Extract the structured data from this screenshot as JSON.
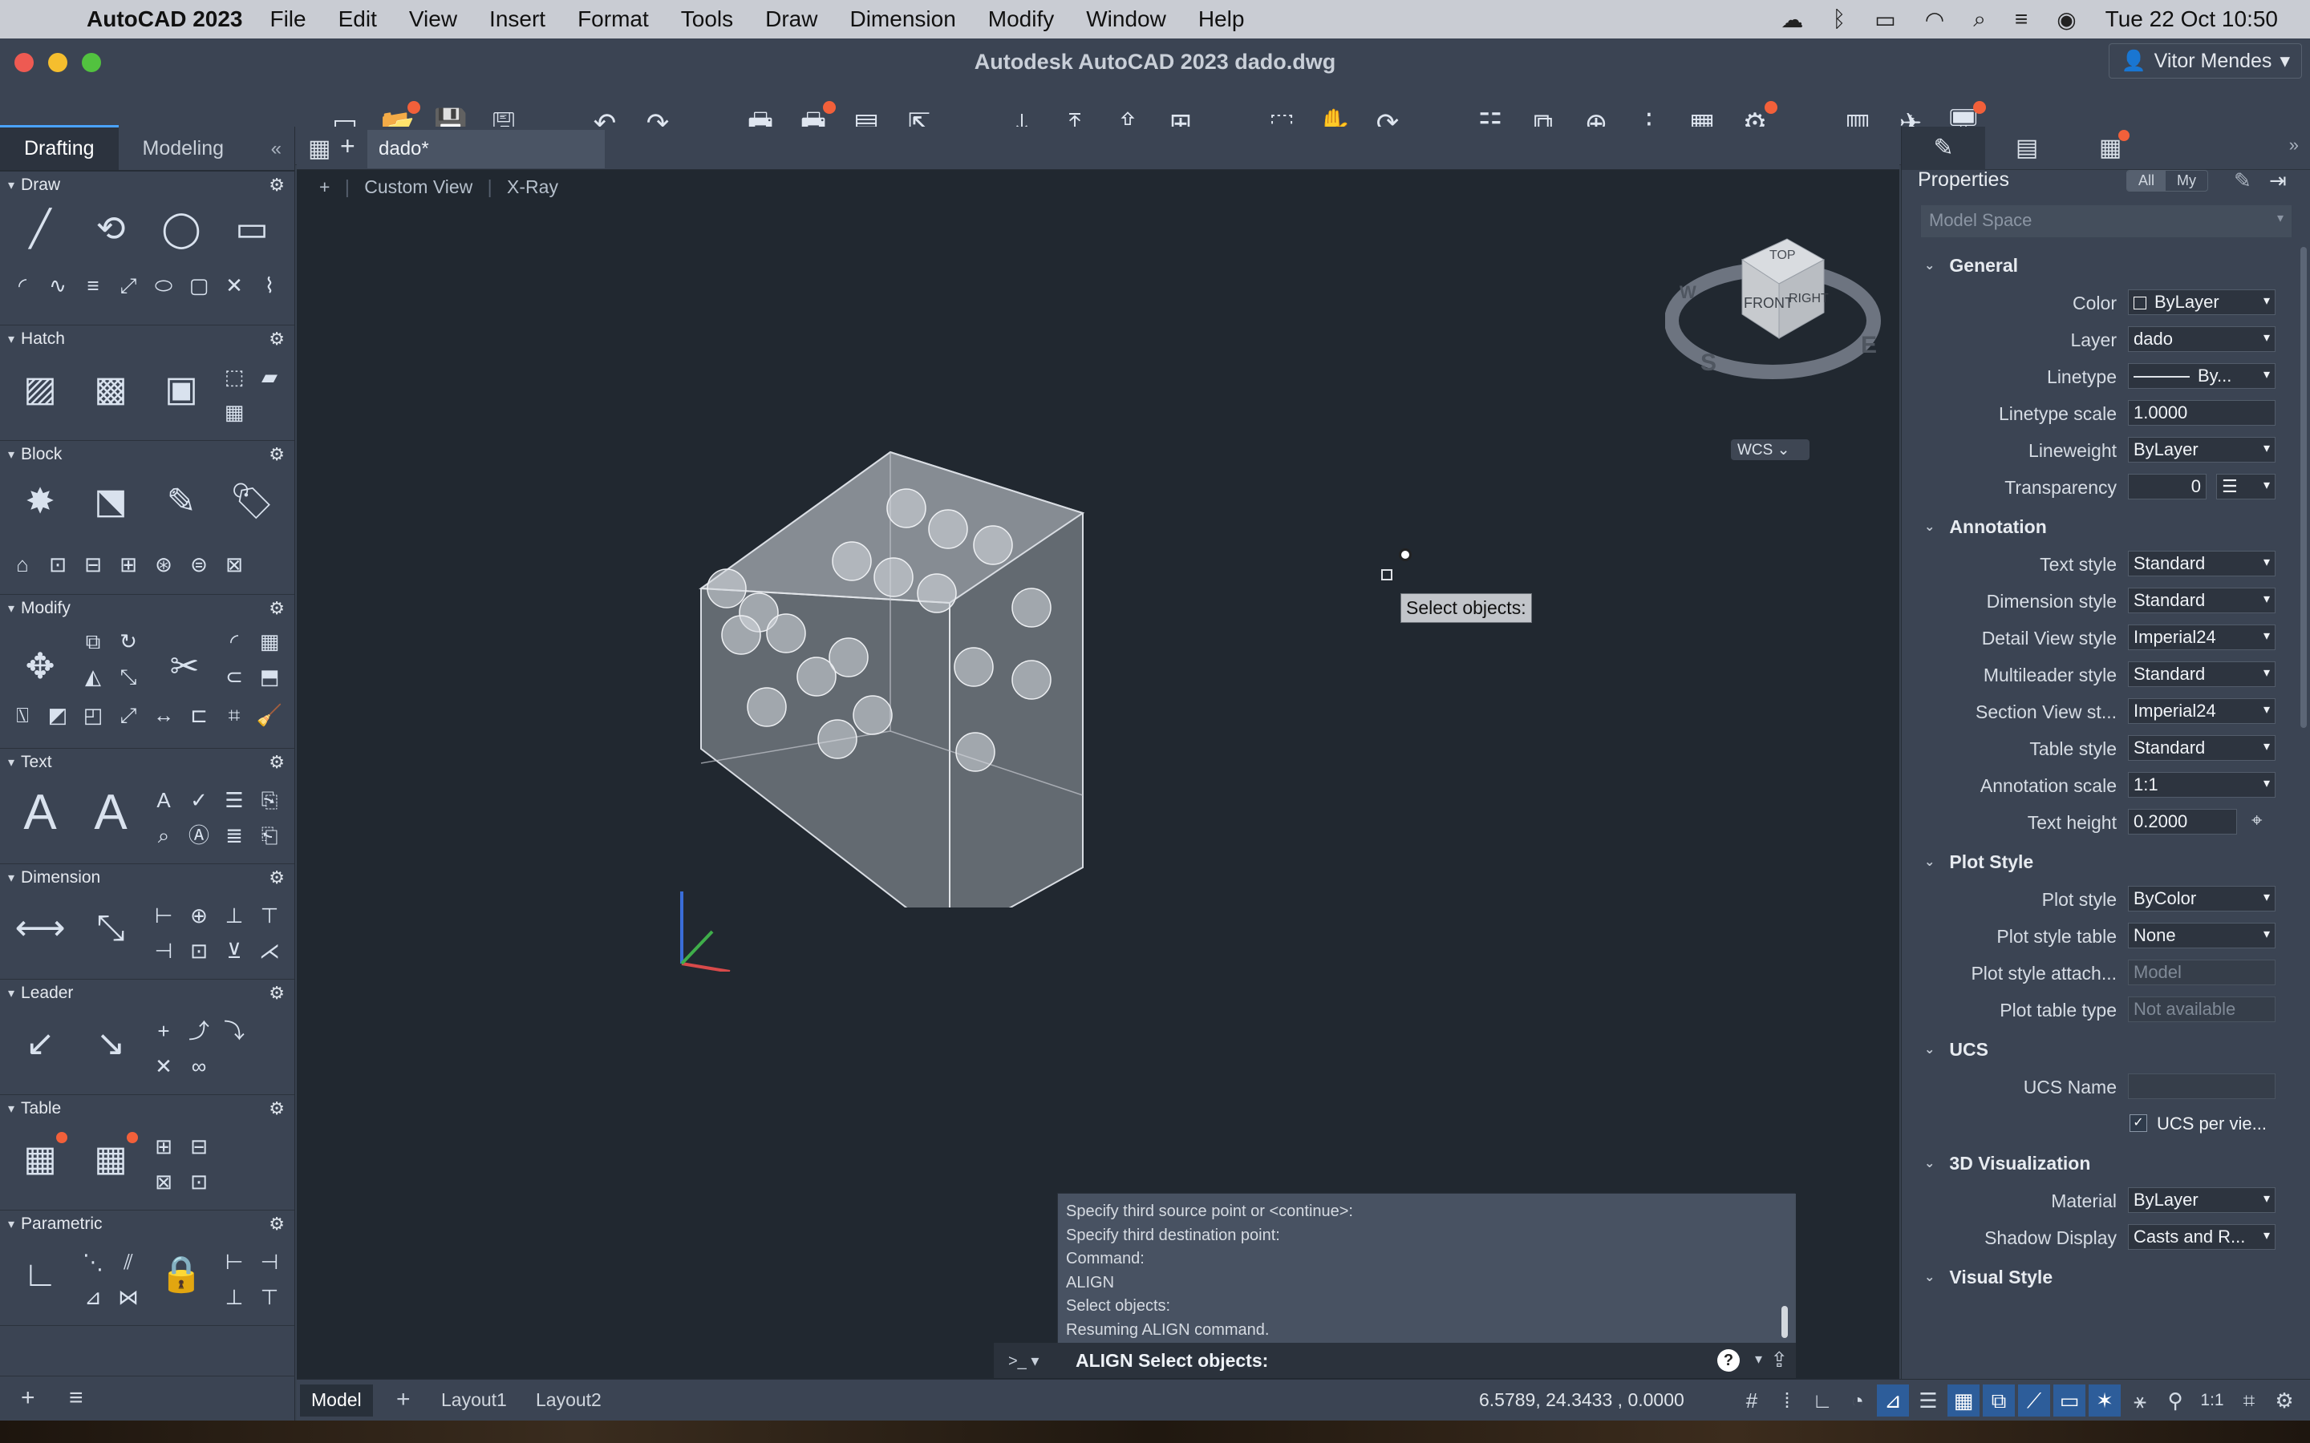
{
  "menubar": {
    "app_name": "AutoCAD 2023",
    "items": [
      "File",
      "Edit",
      "View",
      "Insert",
      "Format",
      "Tools",
      "Draw",
      "Dimension",
      "Modify",
      "Window",
      "Help"
    ],
    "clock": "Tue 22 Oct  10:50"
  },
  "window": {
    "title": "Autodesk AutoCAD 2023    dado.dwg",
    "user": "Vitor Mendes"
  },
  "palette": {
    "tabs": [
      "Drafting",
      "Modeling"
    ],
    "sections": [
      "Draw",
      "Hatch",
      "Block",
      "Modify",
      "Text",
      "Dimension",
      "Leader",
      "Table",
      "Parametric"
    ]
  },
  "doc": {
    "tab_label": "dado*",
    "view_controls": [
      "+",
      "Custom View",
      "X-Ray"
    ],
    "viewcube": {
      "top": "TOP",
      "front": "FRONT",
      "right": "RIGHT",
      "compass_s": "S",
      "compass_e": "E",
      "compass_w": "W",
      "wcs": "WCS"
    },
    "tooltip": "Select objects:"
  },
  "command": {
    "history": [
      "Specify third source point or <continue>:",
      "Specify third destination point:",
      "Command:",
      "ALIGN",
      "Select objects:",
      "Resuming ALIGN command."
    ],
    "prompt_glyph": ">_",
    "current": "ALIGN Select objects:"
  },
  "properties": {
    "title": "Properties",
    "filter": [
      "All",
      "My"
    ],
    "space": "Model Space",
    "categories": [
      {
        "name": "General",
        "rows": [
          {
            "label": "Color",
            "value": "ByLayer",
            "dropdown": true
          },
          {
            "label": "Layer",
            "value": "dado",
            "dropdown": true
          },
          {
            "label": "Linetype",
            "value": "By...",
            "dropdown": true
          },
          {
            "label": "Linetype scale",
            "value": "1.0000",
            "dropdown": false
          },
          {
            "label": "Lineweight",
            "value": "ByLayer",
            "dropdown": true
          },
          {
            "label": "Transparency",
            "value": "0",
            "dropdown": false
          }
        ]
      },
      {
        "name": "Annotation",
        "rows": [
          {
            "label": "Text style",
            "value": "Standard",
            "dropdown": true
          },
          {
            "label": "Dimension style",
            "value": "Standard",
            "dropdown": true
          },
          {
            "label": "Detail View style",
            "value": "Imperial24",
            "dropdown": true
          },
          {
            "label": "Multileader style",
            "value": "Standard",
            "dropdown": true
          },
          {
            "label": "Section View st...",
            "value": "Imperial24",
            "dropdown": true
          },
          {
            "label": "Table style",
            "value": "Standard",
            "dropdown": true
          },
          {
            "label": "Annotation scale",
            "value": "1:1",
            "dropdown": true
          },
          {
            "label": "Text height",
            "value": "0.2000",
            "dropdown": false
          }
        ]
      },
      {
        "name": "Plot Style",
        "rows": [
          {
            "label": "Plot style",
            "value": "ByColor",
            "dropdown": true
          },
          {
            "label": "Plot style table",
            "value": "None",
            "dropdown": true
          },
          {
            "label": "Plot style attach...",
            "value": "Model",
            "dropdown": false,
            "disabled": true
          },
          {
            "label": "Plot table type",
            "value": "Not available",
            "dropdown": false,
            "disabled": true
          }
        ]
      },
      {
        "name": "UCS",
        "rows": [
          {
            "label": "UCS Name",
            "value": "",
            "dropdown": false
          },
          {
            "label": "",
            "value": "UCS per vie...",
            "checkbox": true
          }
        ]
      },
      {
        "name": "3D Visualization",
        "rows": [
          {
            "label": "Material",
            "value": "ByLayer",
            "dropdown": true
          },
          {
            "label": "Shadow Display",
            "value": "Casts and R...",
            "dropdown": true
          }
        ]
      },
      {
        "name": "Visual Style",
        "rows": []
      }
    ]
  },
  "status": {
    "layouts": [
      "Model",
      "Layout1",
      "Layout2"
    ],
    "coords": "6.5789,      24.3433    , 0.0000",
    "scale": "1:1"
  },
  "accent": "#2d5d9a",
  "badge_color": "#f2603a"
}
